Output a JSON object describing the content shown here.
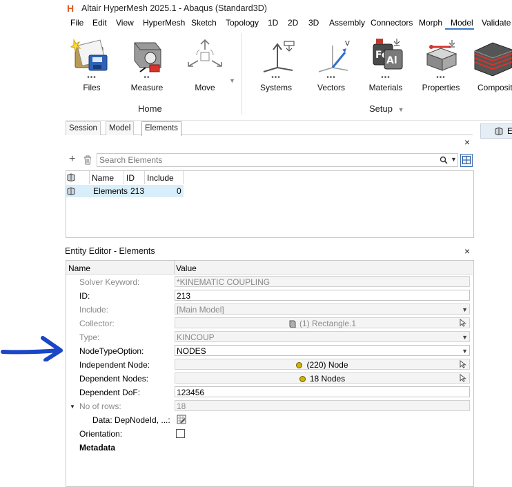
{
  "window": {
    "title": "Altair HyperMesh 2025.1 - Abaqus (Standard3D)",
    "logo_letter": "H"
  },
  "menu": {
    "items": [
      "File",
      "Edit",
      "View",
      "HyperMesh",
      "Sketch",
      "Topology",
      "1D",
      "2D",
      "3D",
      "Assembly",
      "Connectors",
      "Morph",
      "Model",
      "Validate"
    ],
    "active": "Model"
  },
  "ribbon": {
    "home_group": "Home",
    "setup_group": "Setup",
    "tools": {
      "files": "Files",
      "measure": "Measure",
      "move": "Move",
      "systems": "Systems",
      "vectors": "Vectors",
      "materials": "Materials",
      "properties": "Properties",
      "composites": "Composite"
    },
    "dots": "•••",
    "measure_dots": "••"
  },
  "tabs": {
    "session": "Session",
    "model": "Model",
    "elements": "Elements"
  },
  "right_button": {
    "label": "E"
  },
  "browser": {
    "close": "×",
    "add": "+",
    "search_placeholder": "Search Elements",
    "columns": {
      "name": "Name",
      "id": "ID",
      "include": "Include"
    },
    "row": {
      "name": "Elements",
      "id": "213",
      "include": "0"
    }
  },
  "entity_editor": {
    "title": "Entity Editor - Elements",
    "close": "×",
    "columns": {
      "name": "Name",
      "value": "Value"
    },
    "rows": {
      "solver_keyword": {
        "label": "Solver Keyword:",
        "value": "*KINEMATIC COUPLING"
      },
      "id": {
        "label": "ID:",
        "value": "213"
      },
      "include": {
        "label": "Include:",
        "value": "[Main Model]"
      },
      "collector": {
        "label": "Collector:",
        "value": "(1) Rectangle.1"
      },
      "type": {
        "label": "Type:",
        "value": "KINCOUP"
      },
      "node_type_option": {
        "label": "NodeTypeOption:",
        "value": "NODES"
      },
      "independent_node": {
        "label": "Independent Node:",
        "value": "(220) Node"
      },
      "dependent_nodes": {
        "label": "Dependent Nodes:",
        "value": "18 Nodes"
      },
      "dependent_dof": {
        "label": "Dependent DoF:",
        "value": "123456"
      },
      "no_of_rows": {
        "label": "No of rows:",
        "value": "18"
      },
      "data": {
        "label": "Data: DepNodeId, ...:"
      },
      "orientation": {
        "label": "Orientation:"
      },
      "metadata": {
        "label": "Metadata"
      }
    }
  },
  "colors": {
    "accent": "#3b77c4",
    "annotation_arrow": "#1a46c8",
    "logo": "#e2591f"
  }
}
